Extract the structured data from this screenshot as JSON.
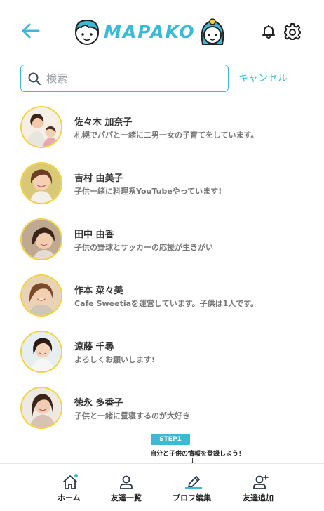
{
  "header": {
    "logo_text": "MAPAKO",
    "back_icon": "arrow-left-icon",
    "notification_icon": "bell-icon",
    "settings_icon": "gear-icon",
    "accent_color": "#3db9d8"
  },
  "search": {
    "placeholder": "検索",
    "value": "",
    "cancel_label": "キャンセル"
  },
  "users": [
    {
      "name": "佐々木 加奈子",
      "bio": "札幌でパパと一緒に二男一女の子育てをしています。"
    },
    {
      "name": "吉村 由美子",
      "bio": "子供一緒に料理系YouTubeやっています!"
    },
    {
      "name": "田中 由香",
      "bio": "子供の野球とサッカーの応援が生きがい"
    },
    {
      "name": "作本 菜々美",
      "bio": "Cafe Sweetiaを運営しています。子供は1人です。"
    },
    {
      "name": "遠藤 千尋",
      "bio": "よろしくお願いします!"
    },
    {
      "name": "徳永 多香子",
      "bio": "子供と一緒に昼寝するのが大好き"
    }
  ],
  "step_tip": {
    "badge": "STEP1",
    "text": "自分と子供の情報を登録しよう！",
    "arrow": "↓"
  },
  "bottom_nav": [
    {
      "label": "ホーム",
      "icon": "home-icon"
    },
    {
      "label": "友達一覧",
      "icon": "person-icon"
    },
    {
      "label": "プロフ編集",
      "icon": "pencil-icon",
      "active": true
    },
    {
      "label": "友達追加",
      "icon": "person-add-icon"
    }
  ]
}
